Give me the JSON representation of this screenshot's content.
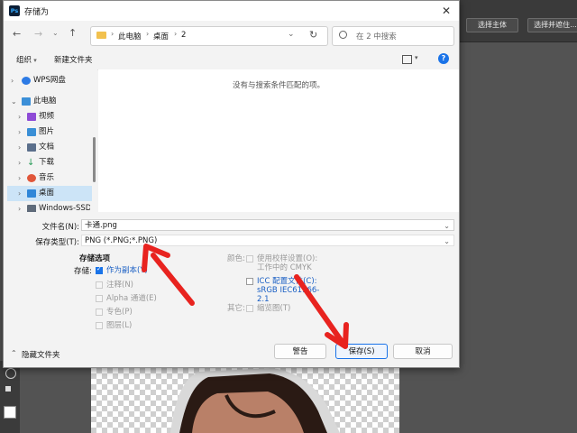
{
  "dialog": {
    "title": "存储为",
    "app_icon_text": "Ps"
  },
  "nav": {
    "breadcrumb": [
      "此电脑",
      "桌面",
      "2"
    ],
    "search_placeholder": "在 2 中搜索"
  },
  "toolbar": {
    "organize": "组织",
    "new_folder": "新建文件夹"
  },
  "sidebar": {
    "items": [
      {
        "label": "WPS网盘",
        "icon_color": "#2d7be5"
      },
      {
        "label": "此电脑",
        "icon_color": "#3b8fd8"
      },
      {
        "label": "视频",
        "icon_color": "#8e4bd6"
      },
      {
        "label": "图片",
        "icon_color": "#3a8fd6"
      },
      {
        "label": "文档",
        "icon_color": "#5b6f8c"
      },
      {
        "label": "下载",
        "icon_color": "#2b9d5a"
      },
      {
        "label": "音乐",
        "icon_color": "#e0563a"
      },
      {
        "label": "桌面",
        "icon_color": "#2f86d8"
      },
      {
        "label": "Windows-SSD (",
        "icon_color": "#5f6b7a"
      }
    ]
  },
  "filepane": {
    "empty_message": "没有与搜索条件匹配的项。"
  },
  "form": {
    "filename_label": "文件名(N):",
    "filename_value": "卡通.png",
    "filetype_label": "保存类型(T):",
    "filetype_value": "PNG (*.PNG;*.PNG)"
  },
  "options": {
    "section_title": "存储选项",
    "store_label": "存储:",
    "as_copy": "作为副本(Y)",
    "notes": "注释(N)",
    "alpha": "Alpha 通道(E)",
    "spot": "专色(P)",
    "layers": "图层(L)",
    "color_label": "颜色:",
    "proof_setup": "使用校样设置(O): 工作中的 CMYK",
    "icc_profile": "ICC 配置文件(C): sRGB IEC61966-2.1",
    "other_label": "其它:",
    "thumbnail": "缩览图(T)"
  },
  "footer": {
    "hide_folders": "隐藏文件夹",
    "warning": "警告",
    "save": "保存(S)",
    "cancel": "取消"
  },
  "photoshop": {
    "select_subject": "选择主体",
    "select_and_mask": "选择并遮住..."
  },
  "colors": {
    "accent": "#1a73e8",
    "arrow": "#e8231f"
  }
}
